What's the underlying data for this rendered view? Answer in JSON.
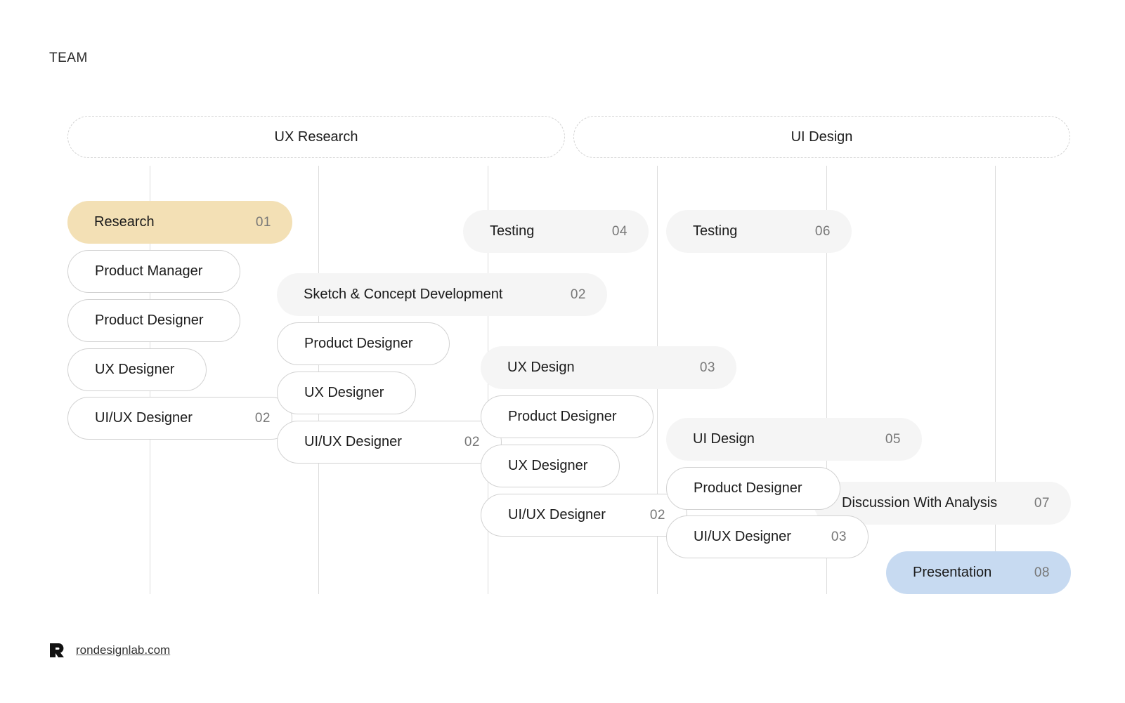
{
  "title": "TEAM",
  "phases": [
    {
      "label": "UX Research"
    },
    {
      "label": "UI Design"
    }
  ],
  "steps": [
    {
      "label": "Research",
      "num": "01",
      "kind": "highlight-yellow"
    },
    {
      "label": "Product Manager",
      "num": "",
      "kind": "role"
    },
    {
      "label": "Product Designer",
      "num": "",
      "kind": "role"
    },
    {
      "label": "UX Designer",
      "num": "",
      "kind": "role"
    },
    {
      "label": "UI/UX Designer",
      "num": "02",
      "kind": "role"
    },
    {
      "label": "Sketch & Concept Development",
      "num": "02",
      "kind": "task"
    },
    {
      "label": "Product Designer",
      "num": "",
      "kind": "role"
    },
    {
      "label": "UX Designer",
      "num": "",
      "kind": "role"
    },
    {
      "label": "UI/UX Designer",
      "num": "02",
      "kind": "role"
    },
    {
      "label": "Testing",
      "num": "04",
      "kind": "task"
    },
    {
      "label": "UX Design",
      "num": "03",
      "kind": "task"
    },
    {
      "label": "Product Designer",
      "num": "",
      "kind": "role"
    },
    {
      "label": "UX Designer",
      "num": "",
      "kind": "role"
    },
    {
      "label": "UI/UX Designer",
      "num": "02",
      "kind": "role"
    },
    {
      "label": "Testing",
      "num": "06",
      "kind": "task"
    },
    {
      "label": "UI Design",
      "num": "05",
      "kind": "task"
    },
    {
      "label": "Product Designer",
      "num": "",
      "kind": "role"
    },
    {
      "label": "UI/UX Designer",
      "num": "03",
      "kind": "role"
    },
    {
      "label": "Discussion With Analysis",
      "num": "07",
      "kind": "task"
    },
    {
      "label": "Presentation",
      "num": "08",
      "kind": "highlight-blue"
    }
  ],
  "footer": {
    "link": "rondesignlab.com",
    "logo_icon": "r-logo-icon"
  },
  "colors": {
    "research": "#f3e0b5",
    "presentation": "#c7daf1",
    "task": "#f5f5f5"
  }
}
